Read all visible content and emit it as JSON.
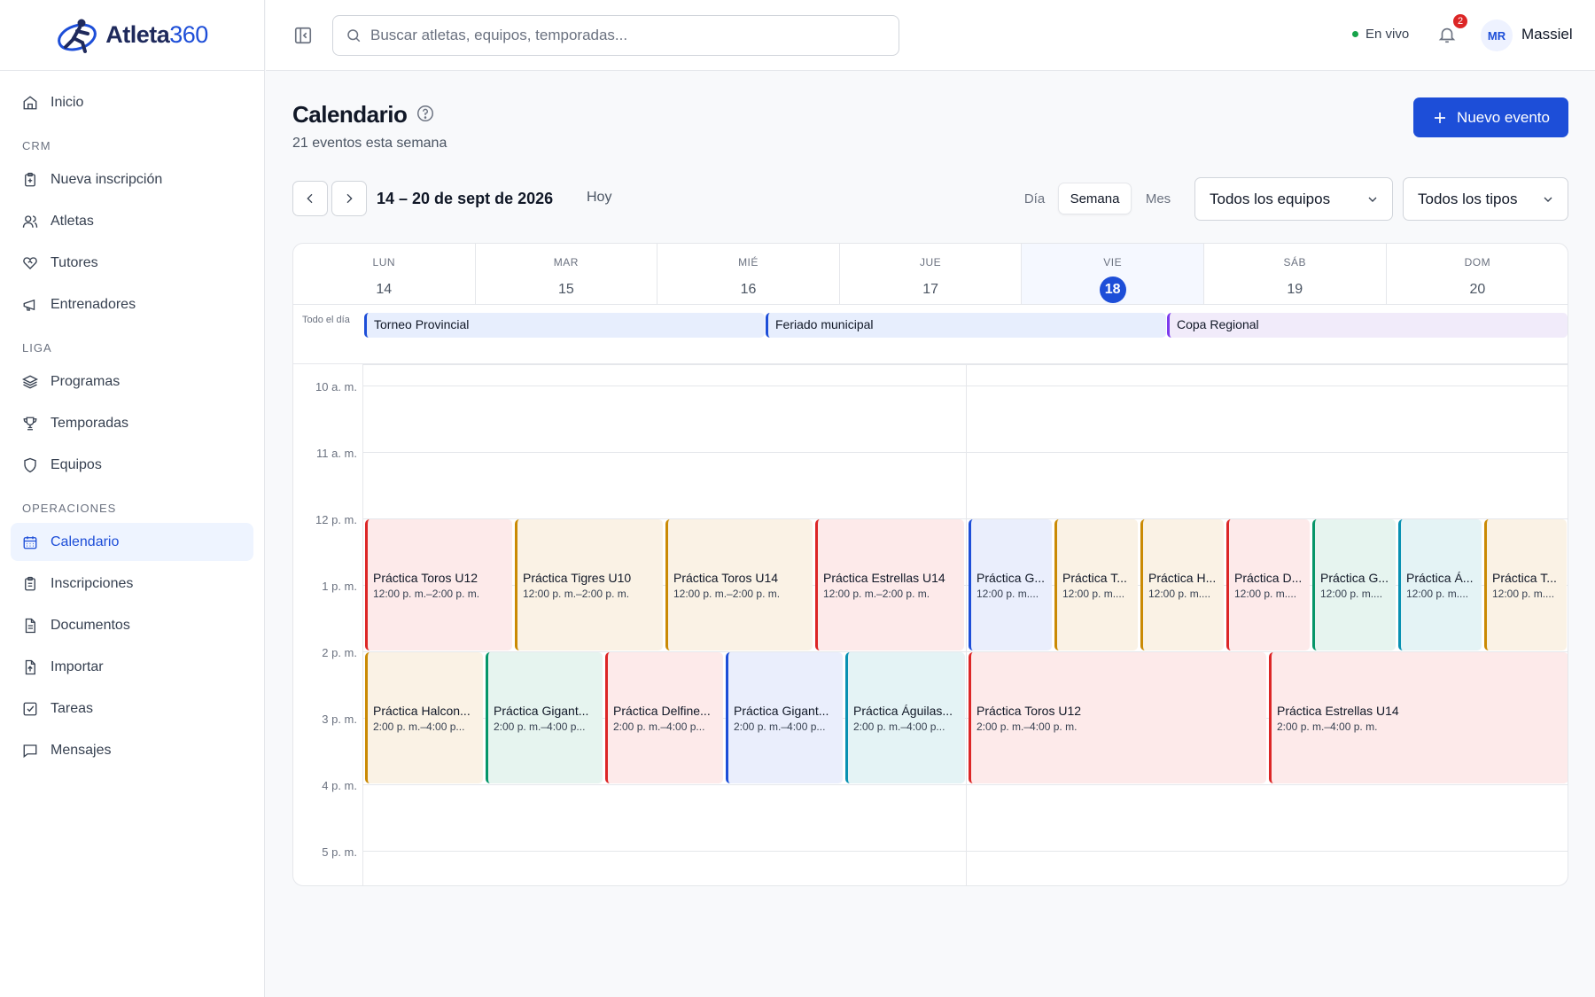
{
  "brand": {
    "name": "Atleta",
    "suffix": "360"
  },
  "nav": {
    "inicio": "Inicio",
    "crm_title": "CRM",
    "crm": [
      "Nueva inscripción",
      "Atletas",
      "Tutores",
      "Entrenadores"
    ],
    "liga_title": "LIGA",
    "liga": [
      "Programas",
      "Temporadas",
      "Equipos"
    ],
    "ops_title": "OPERACIONES",
    "ops": [
      "Calendario",
      "Inscripciones",
      "Documentos",
      "Importar",
      "Tareas",
      "Mensajes"
    ]
  },
  "topbar": {
    "search_placeholder": "Buscar atletas, equipos, temporadas...",
    "live": "En vivo",
    "notif_count": "2",
    "avatar": "MR",
    "user": "Massiel"
  },
  "page": {
    "title": "Calendario",
    "subtitle": "21 eventos esta semana",
    "new_event": "Nuevo evento"
  },
  "toolbar": {
    "range": "14 – 20 de sept de 2026",
    "today": "Hoy",
    "view_day": "Día",
    "view_week": "Semana",
    "view_month": "Mes",
    "filter_teams": "Todos los equipos",
    "filter_types": "Todos los tipos"
  },
  "calendar": {
    "days": [
      {
        "dow": "LUN",
        "num": "14"
      },
      {
        "dow": "MAR",
        "num": "15"
      },
      {
        "dow": "MIÉ",
        "num": "16"
      },
      {
        "dow": "JUE",
        "num": "17"
      },
      {
        "dow": "VIE",
        "num": "18",
        "today": true
      },
      {
        "dow": "SÁB",
        "num": "19"
      },
      {
        "dow": "DOM",
        "num": "20"
      }
    ],
    "allday_label": "Todo el día",
    "allday_events": [
      {
        "title": "Torneo Provincial",
        "color": "#1d4ed8",
        "bg": "#e7eefd"
      },
      {
        "title": "Feriado municipal",
        "color": "#1d4ed8",
        "bg": "#e7eefd"
      },
      {
        "title": "Copa Regional",
        "color": "#7c3aed",
        "bg": "#f1ebfa"
      }
    ],
    "hours": [
      "10 a. m.",
      "11 a. m.",
      "12 p. m.",
      "1 p. m.",
      "2 p. m.",
      "3 p. m.",
      "4 p. m.",
      "5 p. m."
    ],
    "noon_events": [
      {
        "title": "Práctica Toros U12",
        "time": "12:00 p. m.–2:00 p. m.",
        "color": "#dc2626",
        "bg": "#fdeaea"
      },
      {
        "title": "Práctica Tigres U10",
        "time": "12:00 p. m.–2:00 p. m.",
        "color": "#ca8a04",
        "bg": "#faf2e5"
      },
      {
        "title": "Práctica Toros U14",
        "time": "12:00 p. m.–2:00 p. m.",
        "color": "#ca8a04",
        "bg": "#faf2e5"
      },
      {
        "title": "Práctica Estrellas U14",
        "time": "12:00 p. m.–2:00 p. m.",
        "color": "#dc2626",
        "bg": "#fdeaea"
      },
      {
        "title": "Práctica G...",
        "time": "12:00 p. m....",
        "color": "#1d4ed8",
        "bg": "#eaeefc"
      },
      {
        "title": "Práctica T...",
        "time": "12:00 p. m....",
        "color": "#ca8a04",
        "bg": "#faf2e5"
      },
      {
        "title": "Práctica H...",
        "time": "12:00 p. m....",
        "color": "#ca8a04",
        "bg": "#faf2e5"
      },
      {
        "title": "Práctica D...",
        "time": "12:00 p. m....",
        "color": "#dc2626",
        "bg": "#fdeaea"
      },
      {
        "title": "Práctica G...",
        "time": "12:00 p. m....",
        "color": "#059669",
        "bg": "#e6f4ef"
      },
      {
        "title": "Práctica Á...",
        "time": "12:00 p. m....",
        "color": "#0891b2",
        "bg": "#e4f3f5"
      },
      {
        "title": "Práctica T...",
        "time": "12:00 p. m....",
        "color": "#ca8a04",
        "bg": "#faf2e5"
      }
    ],
    "afternoon_events": [
      {
        "title": "Práctica Halcon...",
        "time": "2:00 p. m.–4:00 p...",
        "color": "#ca8a04",
        "bg": "#faf2e5"
      },
      {
        "title": "Práctica Gigant...",
        "time": "2:00 p. m.–4:00 p...",
        "color": "#059669",
        "bg": "#e6f4ef"
      },
      {
        "title": "Práctica Delfine...",
        "time": "2:00 p. m.–4:00 p...",
        "color": "#dc2626",
        "bg": "#fdeaea"
      },
      {
        "title": "Práctica Gigant...",
        "time": "2:00 p. m.–4:00 p...",
        "color": "#1d4ed8",
        "bg": "#eaeefc"
      },
      {
        "title": "Práctica Águilas...",
        "time": "2:00 p. m.–4:00 p...",
        "color": "#0891b2",
        "bg": "#e4f3f5"
      },
      {
        "title": "Práctica Toros U12",
        "time": "2:00 p. m.–4:00 p. m.",
        "color": "#dc2626",
        "bg": "#fdeaea"
      },
      {
        "title": "Práctica Estrellas U14",
        "time": "2:00 p. m.–4:00 p. m.",
        "color": "#dc2626",
        "bg": "#fdeaea"
      }
    ]
  }
}
